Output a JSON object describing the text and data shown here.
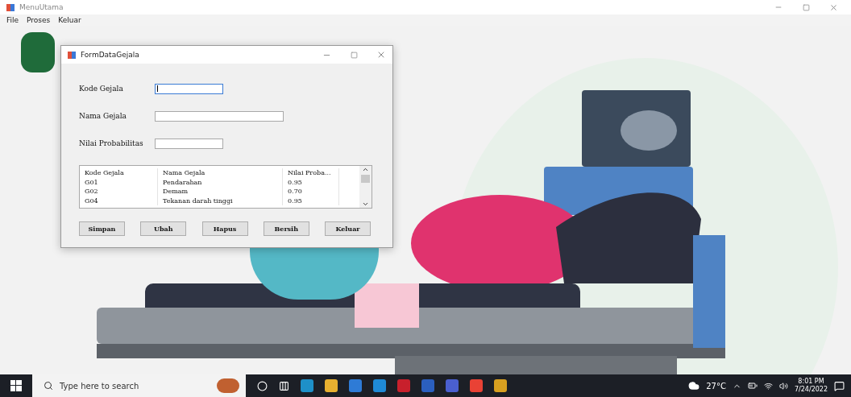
{
  "app_window": {
    "title": "MenuUtama",
    "menu": [
      "File",
      "Proses",
      "Keluar"
    ]
  },
  "dialog": {
    "title": "FormDataGejala",
    "fields": [
      {
        "label": "Kode Gejala",
        "kind": "short",
        "focused": true
      },
      {
        "label": "Nama Gejala",
        "kind": "long",
        "focused": false
      },
      {
        "label": "Nilai Probabilitas",
        "kind": "short",
        "focused": false
      }
    ],
    "table": {
      "columns": [
        "Kode Gejala",
        "Nama Gejala",
        "Nilai Proba..."
      ],
      "rows": [
        [
          "G01",
          "Pendarahan",
          "0.95"
        ],
        [
          "G02",
          "Demam",
          "0.70"
        ],
        [
          "G04",
          "Tekanan darah tinggi",
          "0.95"
        ]
      ]
    },
    "buttons": [
      "Simpan",
      "Ubah",
      "Hapus",
      "Bersih",
      "Keluar"
    ]
  },
  "taskbar": {
    "search": {
      "placeholder": "Type here to search"
    },
    "weather": "27°C",
    "time": "8:01 PM",
    "date": "7/24/2022"
  }
}
